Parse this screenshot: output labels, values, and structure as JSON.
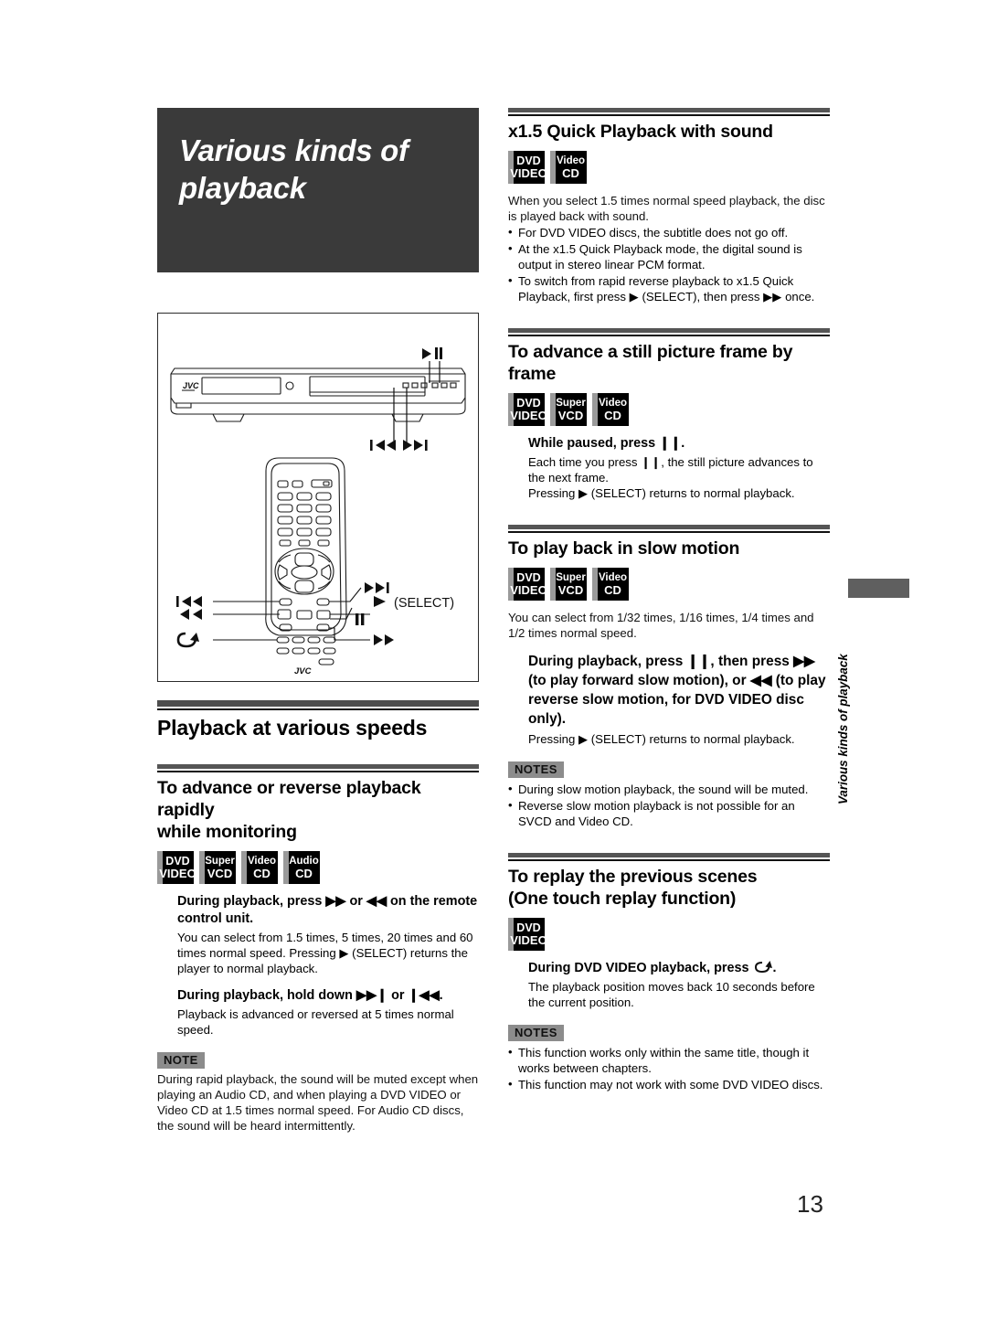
{
  "page": {
    "number": "13",
    "side_tab": "Various kinds of playback"
  },
  "chapter": {
    "title_line1": "Various kinds of",
    "title_line2": "playback"
  },
  "badges": {
    "dvd_video": {
      "line1": "DVD",
      "line2": "VIDEO"
    },
    "super_vcd": {
      "line1": "Super",
      "line2": "VCD"
    },
    "video_cd": {
      "line1": "Video",
      "line2": "CD"
    },
    "audio_cd": {
      "line1": "Audio",
      "line2": "CD"
    }
  },
  "illustration": {
    "player_brand": "JVC",
    "remote_brand": "JVC",
    "player_callouts": {
      "play_pause": "▶ ❙❙",
      "skip_prev": "❙◀◀",
      "skip_next": "▶▶❙"
    },
    "remote_callouts": {
      "skip_prev": "❙◀◀",
      "rewind": "◀◀",
      "replay": "replay-arrow",
      "skip_next": "▶▶❙",
      "select": "▶ (SELECT)",
      "pause": "❙❙",
      "forward": "▶▶"
    },
    "select_label": "(SELECT)"
  },
  "left_column": {
    "section_speeds": {
      "title": "Playback at various speeds"
    },
    "section_rapid": {
      "title_line1": "To advance or reverse playback rapidly",
      "title_line2": "while monitoring",
      "badges": [
        "dvd_video",
        "super_vcd",
        "video_cd",
        "audio_cd"
      ],
      "step1": "During playback, press ▶▶ or ◀◀ on the remote control unit.",
      "step1_body": "You can select from 1.5 times, 5 times, 20 times and 60 times normal speed. Pressing ▶ (SELECT) returns the player to normal playback.",
      "step2": "During playback, hold down ▶▶❙ or ❙◀◀.",
      "step2_body": "Playback is advanced or reversed at 5 times normal speed.",
      "note_label": "NOTE",
      "note_body": "During rapid playback, the sound will be muted except when playing an Audio CD, and when playing a DVD VIDEO or Video CD at 1.5 times normal speed. For Audio CD discs, the sound will be heard intermittently."
    }
  },
  "right_column": {
    "section_quick": {
      "title": "x1.5 Quick Playback with sound",
      "badges": [
        "dvd_video",
        "video_cd"
      ],
      "intro": "When you select 1.5 times normal speed playback, the disc is played back with sound.",
      "bullets": [
        "For DVD VIDEO discs, the subtitle does not go off.",
        "At the x1.5 Quick Playback mode, the digital sound is output in stereo linear PCM format.",
        "To switch from rapid reverse playback to x1.5 Quick Playback, first press ▶ (SELECT), then press ▶▶ once."
      ]
    },
    "section_frame": {
      "title": "To advance a still picture frame by frame",
      "badges": [
        "dvd_video",
        "super_vcd",
        "video_cd"
      ],
      "step": "While paused, press ❙❙.",
      "body1": "Each time you press ❙❙, the still picture advances to the next frame.",
      "body2": "Pressing ▶ (SELECT) returns to normal playback."
    },
    "section_slow": {
      "title": "To play back in slow motion",
      "badges": [
        "dvd_video",
        "super_vcd",
        "video_cd"
      ],
      "intro": "You can select from 1/32 times, 1/16 times, 1/4 times and 1/2 times normal speed.",
      "step": "During playback, press ❙❙, then press ▶▶ (to play forward slow motion), or ◀◀ (to play reverse slow motion, for DVD VIDEO disc only).",
      "body": "Pressing ▶ (SELECT) returns to normal playback.",
      "notes_label": "NOTES",
      "notes": [
        "During slow motion playback, the sound will be muted.",
        "Reverse slow motion playback is not possible for an SVCD and Video CD."
      ]
    },
    "section_replay": {
      "title_line1": "To replay the previous scenes",
      "title_line2": "(One touch replay function)",
      "badges": [
        "dvd_video"
      ],
      "step_prefix": "During DVD VIDEO playback, press",
      "step_suffix": ".",
      "body": "The playback position moves back 10 seconds before the current position.",
      "notes_label": "NOTES",
      "notes": [
        "This function works only within the same title, though it works between chapters.",
        "This function may not work with some DVD VIDEO discs."
      ]
    }
  }
}
